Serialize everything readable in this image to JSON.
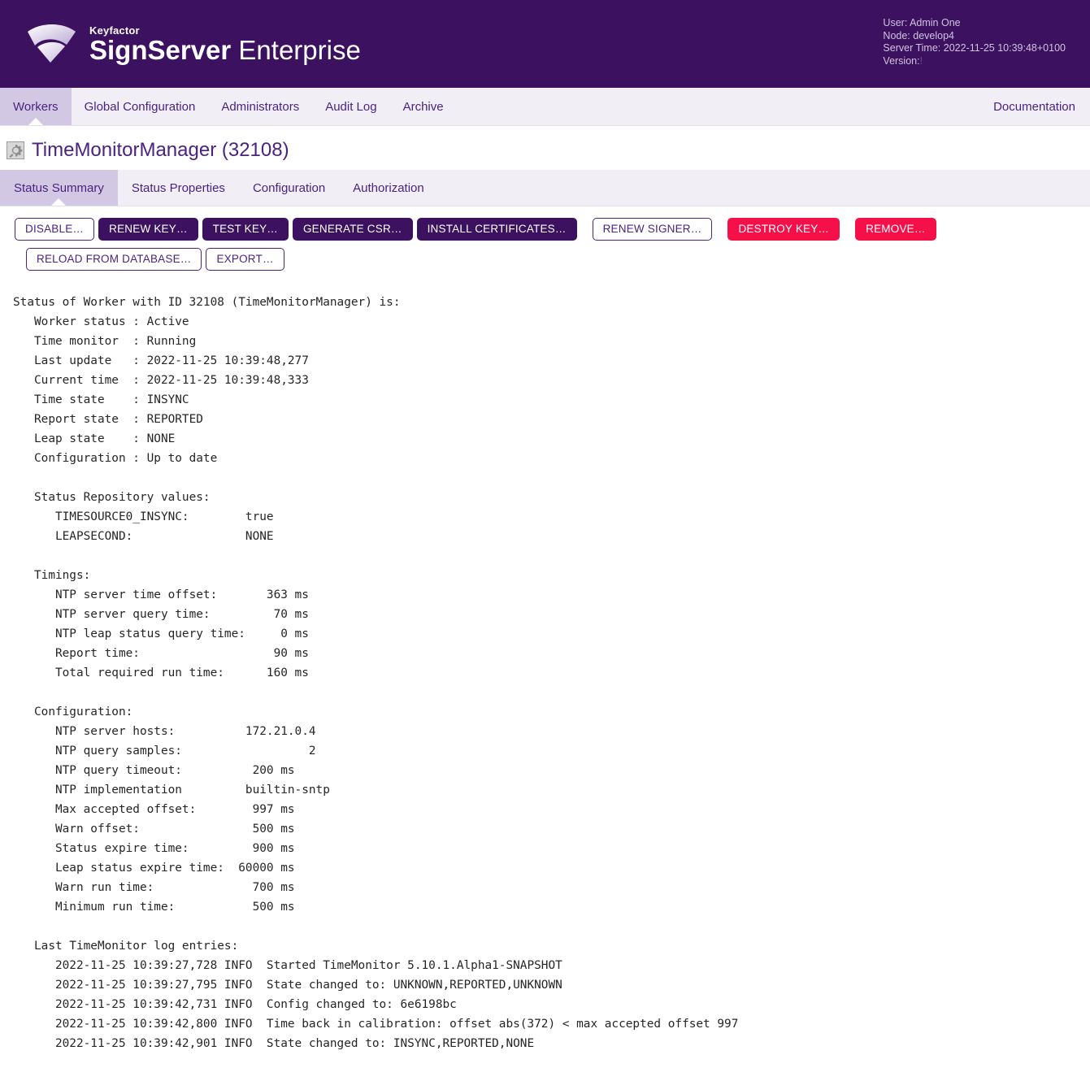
{
  "header": {
    "brand_small": "Keyfactor",
    "brand_bold": "SignServer",
    "brand_light": "Enterprise",
    "user_label": "User: Admin One",
    "node_label": "Node: develop4",
    "server_time_label": "Server Time: 2022-11-25 10:39:48+0100",
    "version_label": "Version:",
    "version_value": "!"
  },
  "mainnav": {
    "items": [
      {
        "label": "Workers",
        "active": true
      },
      {
        "label": "Global Configuration",
        "active": false
      },
      {
        "label": "Administrators",
        "active": false
      },
      {
        "label": "Audit Log",
        "active": false
      },
      {
        "label": "Archive",
        "active": false
      }
    ],
    "documentation": "Documentation"
  },
  "page": {
    "icon": "worker-gear-icon",
    "title": "TimeMonitorManager (32108)"
  },
  "subtabs": {
    "items": [
      {
        "label": "Status Summary",
        "active": true
      },
      {
        "label": "Status Properties",
        "active": false
      },
      {
        "label": "Configuration",
        "active": false
      },
      {
        "label": "Authorization",
        "active": false
      }
    ]
  },
  "actions": {
    "buttons": [
      {
        "label": "DISABLE…",
        "style": "outline",
        "name": "disable-button"
      },
      {
        "label": "RENEW KEY…",
        "style": "solid",
        "name": "renew-key-button"
      },
      {
        "label": "TEST KEY…",
        "style": "solid",
        "name": "test-key-button"
      },
      {
        "label": "GENERATE CSR…",
        "style": "solid",
        "name": "generate-csr-button"
      },
      {
        "label": "INSTALL CERTIFICATES…",
        "style": "solid",
        "name": "install-certificates-button"
      },
      {
        "label": "RENEW SIGNER…",
        "style": "outline gap-left",
        "name": "renew-signer-button"
      },
      {
        "label": "DESTROY KEY…",
        "style": "danger gap-left",
        "name": "destroy-key-button"
      },
      {
        "label": "REMOVE…",
        "style": "danger gap-left",
        "name": "remove-button"
      },
      {
        "label": "RELOAD FROM DATABASE…",
        "style": "outline gap-left",
        "name": "reload-from-database-button"
      },
      {
        "label": "EXPORT…",
        "style": "outline",
        "name": "export-button"
      }
    ]
  },
  "status_text": "Status of Worker with ID 32108 (TimeMonitorManager) is:\n   Worker status : Active\n   Time monitor  : Running\n   Last update   : 2022-11-25 10:39:48,277\n   Current time  : 2022-11-25 10:39:48,333\n   Time state    : INSYNC\n   Report state  : REPORTED\n   Leap state    : NONE\n   Configuration : Up to date\n\n   Status Repository values:\n      TIMESOURCE0_INSYNC:        true\n      LEAPSECOND:                NONE\n\n   Timings:\n      NTP server time offset:       363 ms\n      NTP server query time:         70 ms\n      NTP leap status query time:     0 ms\n      Report time:                   90 ms\n      Total required run time:      160 ms\n\n   Configuration:\n      NTP server hosts:          172.21.0.4\n      NTP query samples:                  2\n      NTP query timeout:          200 ms\n      NTP implementation         builtin-sntp\n      Max accepted offset:        997 ms\n      Warn offset:                500 ms\n      Status expire time:         900 ms\n      Leap status expire time:  60000 ms\n      Warn run time:              700 ms\n      Minimum run time:           500 ms\n\n   Last TimeMonitor log entries:\n      2022-11-25 10:39:27,728 INFO  Started TimeMonitor 5.10.1.Alpha1-SNAPSHOT\n      2022-11-25 10:39:27,795 INFO  State changed to: UNKNOWN,REPORTED,UNKNOWN\n      2022-11-25 10:39:42,731 INFO  Config changed to: 6e6198bc\n      2022-11-25 10:39:42,800 INFO  Time back in calibration: offset abs(372) < max accepted offset 997\n      2022-11-25 10:39:42,901 INFO  State changed to: INSYNC,REPORTED,NONE",
  "colors": {
    "brand_purple": "#3c1260",
    "accent_link": "#4a2380",
    "tab_active_bg": "#d3c8e3",
    "nav_bg": "#f1eff5",
    "danger": "#f5104a"
  }
}
